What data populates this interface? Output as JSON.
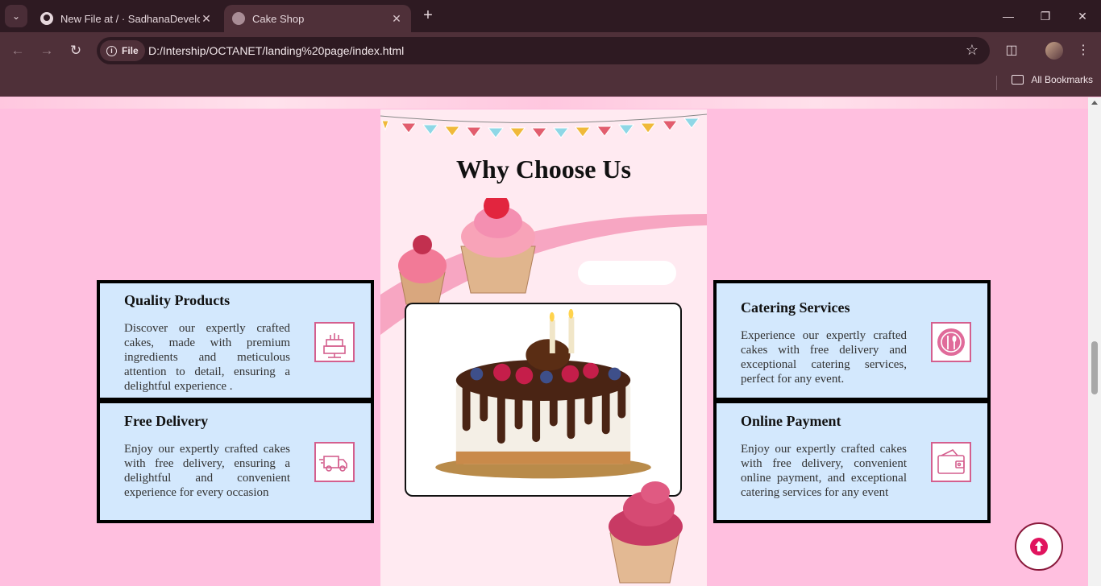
{
  "browser": {
    "tabs": [
      {
        "title": "New File at / · SadhanaDevelop",
        "active": false
      },
      {
        "title": "Cake Shop",
        "active": true
      }
    ],
    "url_chip": "File",
    "url": "D:/Intership/OCTANET/landing%20page/index.html",
    "bookmarks_label": "All Bookmarks"
  },
  "section": {
    "title": "Why Choose Us"
  },
  "features": [
    {
      "title": "Quality Products",
      "text": "Discover our expertly crafted cakes, made with premium ingredients and meticulous attention to detail, ensuring a delightful experience .",
      "icon": "cake-icon"
    },
    {
      "title": "Free Delivery",
      "text": "Enjoy our expertly crafted cakes with free delivery, ensuring a delightful and convenient experience for every occasion",
      "icon": "delivery-truck-icon"
    },
    {
      "title": "Catering Services",
      "text": "Experience our expertly crafted cakes with free delivery and exceptional catering services, perfect for any event.",
      "icon": "catering-plate-icon"
    },
    {
      "title": "Online Payment",
      "text": "Enjoy our expertly crafted cakes with free delivery, convenient online payment, and exceptional catering services for any event",
      "icon": "wallet-icon"
    }
  ],
  "colors": {
    "page_bg": "#ffbfdf",
    "card_bg": "#d3e8fd",
    "icon_stroke": "#d45f8e",
    "accent": "#e0145e"
  }
}
